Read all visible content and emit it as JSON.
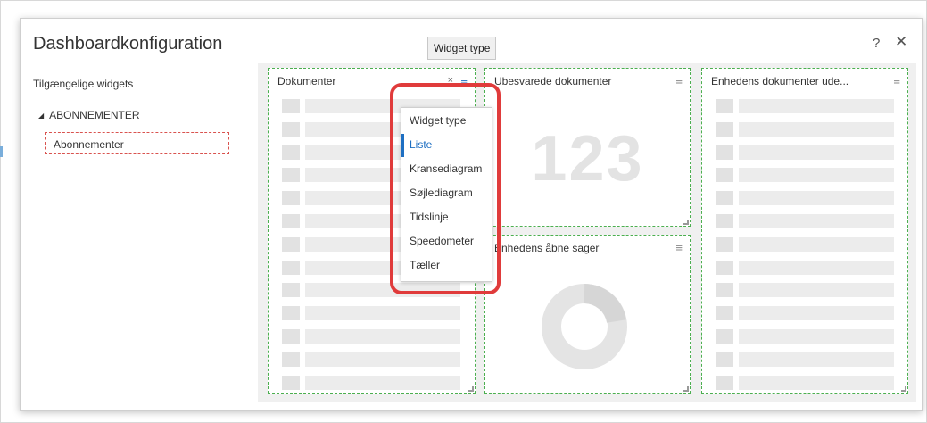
{
  "dialog": {
    "title": "Dashboardkonfiguration",
    "tooltip": "Widget type",
    "help_icon": "?",
    "close_icon": "✕"
  },
  "sidebar": {
    "title": "Tilgængelige widgets",
    "group_label": "ABONNEMENTER",
    "selected_item": "Abonnementer"
  },
  "widgets": {
    "dokumenter": {
      "title": "Dokumenter",
      "close_icon": "×",
      "menu_icon": "≡"
    },
    "ubesvarede": {
      "title": "Ubesvarede dokumenter",
      "menu_icon": "≡",
      "counter": "123"
    },
    "enhedens_aabne": {
      "title": "Enhedens åbne sager",
      "menu_icon": "≡"
    },
    "enhedens_dokumenter": {
      "title": "Enhedens dokumenter ude...",
      "menu_icon": "≡"
    }
  },
  "widget_type_menu": {
    "header": "Widget type",
    "options": [
      "Liste",
      "Kransediagram",
      "Søjlediagram",
      "Tidslinje",
      "Speedometer",
      "Tæller"
    ],
    "selected": "Liste"
  },
  "colors": {
    "highlight": "#e03b3b",
    "widget_border": "#4caf50",
    "active_option": "#1e6fc2",
    "selected_item_border": "#d9534f"
  }
}
